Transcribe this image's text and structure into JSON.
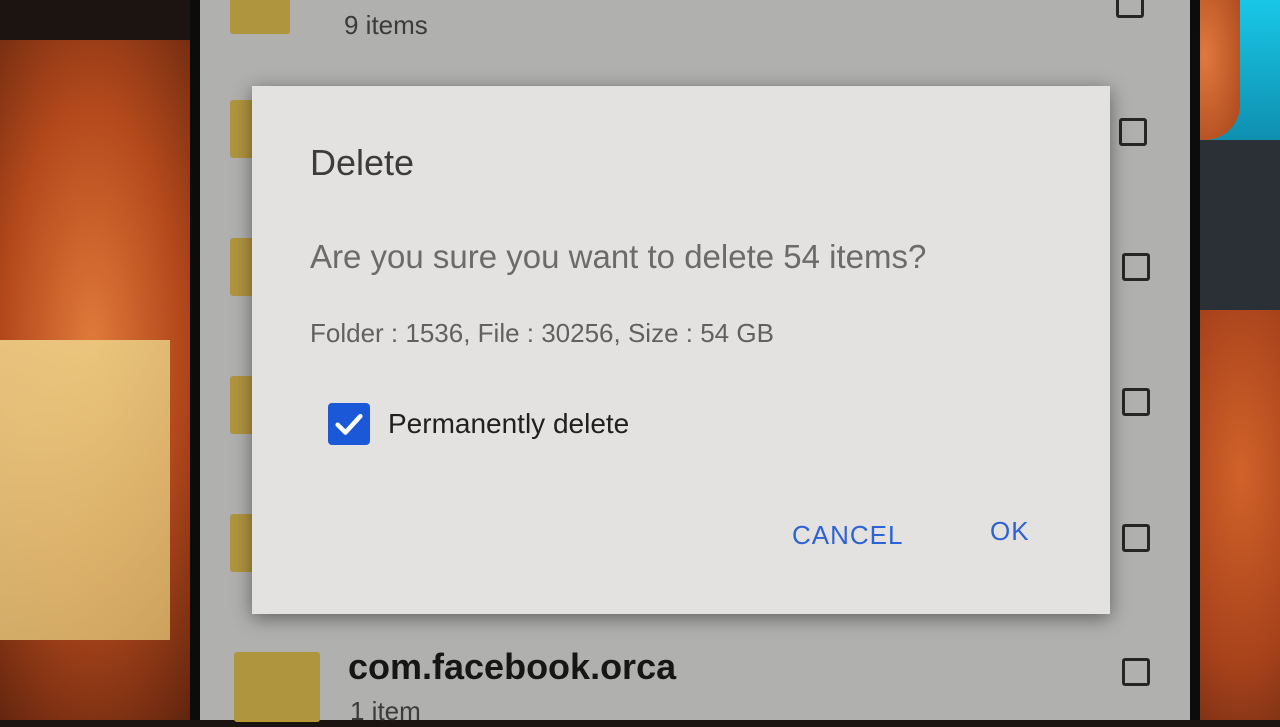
{
  "list": {
    "top_item_subtitle": "9 items",
    "bottom_item_name": "com.facebook.orca",
    "bottom_item_subtitle": "1 item"
  },
  "dialog": {
    "title": "Delete",
    "message": "Are you sure you want to delete 54 items?",
    "details": "Folder : 1536, File : 30256, Size : 54 GB",
    "checkbox_label": "Permanently delete",
    "checkbox_checked": true,
    "cancel_label": "CANCEL",
    "ok_label": "OK"
  },
  "colors": {
    "accent": "#2c62d4",
    "checkbox": "#1a58d8",
    "dialog_bg": "#e4e2e1"
  },
  "icons": [
    "folder-icon",
    "checkbox-icon",
    "check-icon"
  ]
}
